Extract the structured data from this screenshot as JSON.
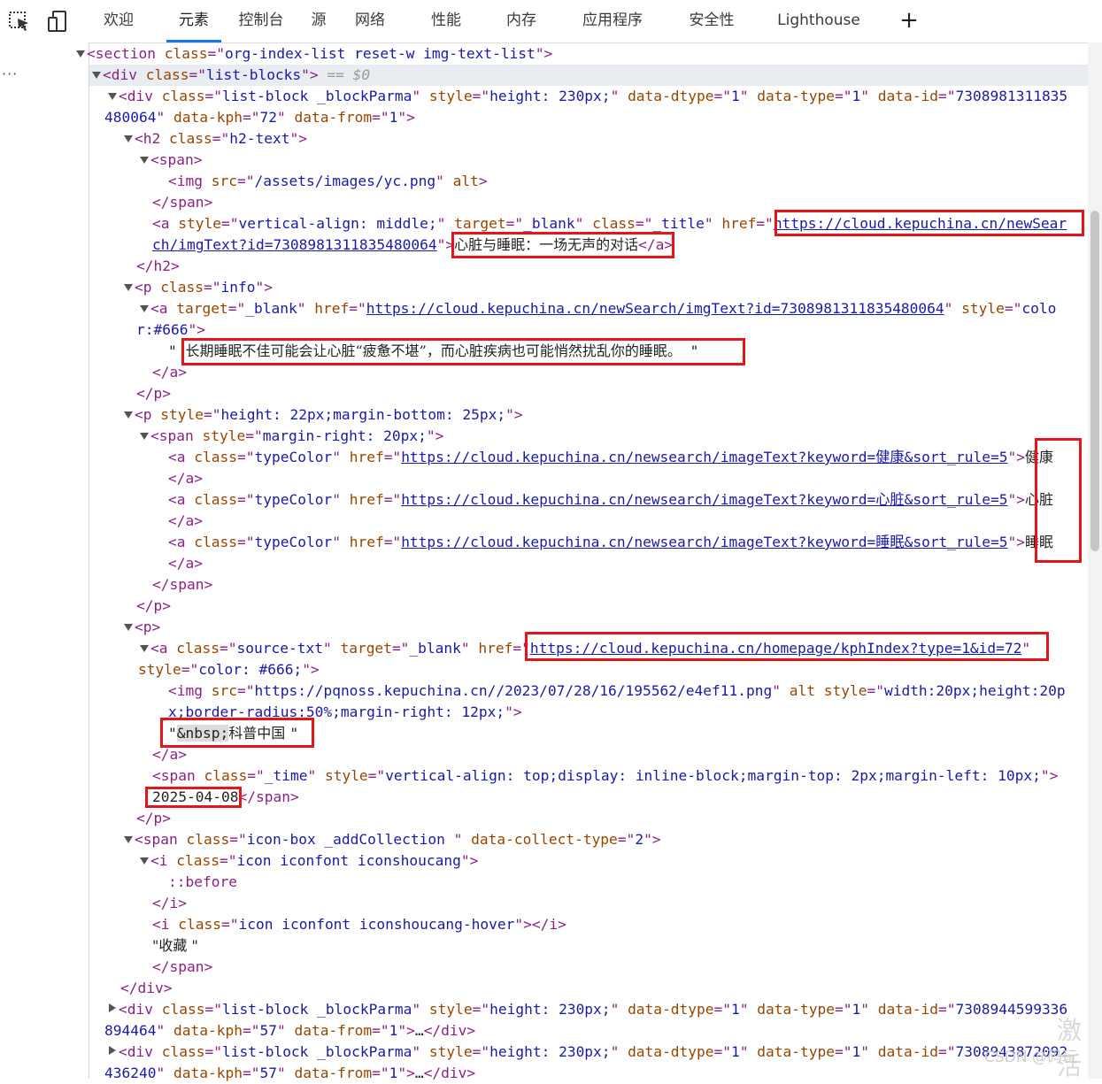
{
  "toolbar": {
    "tabs": [
      "欢迎",
      "元素",
      "控制台",
      "源",
      "网络",
      "性能",
      "内存",
      "应用程序",
      "安全性",
      "Lighthouse"
    ],
    "active_tab": "元素",
    "add_tab_label": "+"
  },
  "gutter": {
    "ellipsis": "···"
  },
  "dom": {
    "l01": [
      "<section ",
      "class",
      "=\"",
      "org-index-list reset-w img-text-list",
      "\">"
    ],
    "l02": [
      "<div ",
      "class",
      "=\"",
      "list-blocks",
      "\">",
      " == $0"
    ],
    "l03": [
      "<div ",
      "class",
      "=\"",
      "list-block _blockParma",
      "\" ",
      "style",
      "=\"",
      "height: 230px;",
      "\" ",
      "data-dtype",
      "=\"",
      "1",
      "\" ",
      "data-type",
      "=\"",
      "1",
      "\" ",
      "data-id",
      "=\"",
      "7308981311835"
    ],
    "l04": [
      "480064",
      "\" ",
      "data-kph",
      "=\"",
      "72",
      "\" ",
      "data-from",
      "=\"",
      "1",
      "\">"
    ],
    "l05": [
      "<h2 ",
      "class",
      "=\"",
      "h2-text",
      "\">"
    ],
    "l06": [
      "<span>"
    ],
    "l07": [
      "<img ",
      "src",
      "=\"",
      "/assets/images/yc.png",
      "\" ",
      "alt",
      ">"
    ],
    "l08": [
      "</span>"
    ],
    "l09": [
      "<a ",
      "style",
      "=\"",
      "vertical-align: middle;",
      "\" ",
      "target",
      "=\"",
      "_blank",
      "\" ",
      "class",
      "=\"",
      "_title",
      "\" ",
      "href",
      "=\"",
      "https://cloud.kepuchina.cn/newSear"
    ],
    "l10": [
      "ch/imgText?id=7308981311835480064",
      "\">",
      "心脏与睡眠：一场无声的对话",
      "</a>"
    ],
    "l11": [
      "</h2>"
    ],
    "l12": [
      "<p ",
      "class",
      "=\"",
      "info",
      "\">"
    ],
    "l13": [
      "<a ",
      "target",
      "=\"",
      "_blank",
      "\" ",
      "href",
      "=\"",
      "https://cloud.kepuchina.cn/newSearch/imgText?id=7308981311835480064",
      "\" ",
      "style",
      "=\"",
      "colo"
    ],
    "l14": [
      "r:#666",
      "\">"
    ],
    "l15": [
      "\" ",
      "长期睡眠不佳可能会让心脏“疲惫不堪”，而心脏疾病也可能悄然扰乱你的睡眠。",
      " \""
    ],
    "l16": [
      "</a>"
    ],
    "l17": [
      "</p>"
    ],
    "l18": [
      "<p ",
      "style",
      "=\"",
      "height: 22px;margin-bottom: 25px;",
      "\">"
    ],
    "l19": [
      "<span ",
      "style",
      "=\"",
      "margin-right: 20px;",
      "\">"
    ],
    "l20": [
      "<a ",
      "class",
      "=\"",
      "typeColor",
      "\" ",
      "href",
      "=\"",
      "https://cloud.kepuchina.cn/newsearch/imageText?keyword=健康&sort_rule=5",
      "\">",
      "健康"
    ],
    "l21": [
      "</a>"
    ],
    "l22": [
      "<a ",
      "class",
      "=\"",
      "typeColor",
      "\" ",
      "href",
      "=\"",
      "https://cloud.kepuchina.cn/newsearch/imageText?keyword=心脏&sort_rule=5",
      "\">",
      "心脏"
    ],
    "l23": [
      "</a>"
    ],
    "l24": [
      "<a ",
      "class",
      "=\"",
      "typeColor",
      "\" ",
      "href",
      "=\"",
      "https://cloud.kepuchina.cn/newsearch/imageText?keyword=睡眠&sort_rule=5",
      "\">",
      "睡眠"
    ],
    "l25": [
      "</a>"
    ],
    "l26": [
      "</span>"
    ],
    "l27": [
      "</p>"
    ],
    "l28": [
      "<p>"
    ],
    "l29": [
      "<a ",
      "class",
      "=\"",
      "source-txt",
      "\" ",
      "target",
      "=\"",
      "_blank",
      "\" ",
      "href",
      "=\"",
      "https://cloud.kepuchina.cn/homepage/kphIndex?type=1&id=72",
      "\""
    ],
    "l30": [
      "style",
      "=\"",
      "color: #666;",
      "\">"
    ],
    "l31": [
      "<img ",
      "src",
      "=\"",
      "https://pqnoss.kepuchina.cn//2023/07/28/16/195562/e4ef11.png",
      "\" ",
      "alt ",
      "style",
      "=\"",
      "width:20px;height:20p"
    ],
    "l32": [
      "x;border-radius:50%;margin-right: 12px;",
      "\">"
    ],
    "l33": [
      "\"",
      "&nbsp;",
      "科普中国 ",
      "\""
    ],
    "l34": [
      "</a>"
    ],
    "l35": [
      "<span ",
      "class",
      "=\"",
      "_time",
      "\" ",
      "style",
      "=\"",
      "vertical-align: top;display: inline-block;margin-top: 2px;margin-left: 10px;",
      "\">"
    ],
    "l36": [
      "2025-04-08",
      "</span>"
    ],
    "l37": [
      "</p>"
    ],
    "l38": [
      "<span ",
      "class",
      "=\"",
      "icon-box _addCollection ",
      "\" ",
      "data-collect-type",
      "=\"",
      "2",
      "\">"
    ],
    "l39": [
      "<i ",
      "class",
      "=\"",
      "icon iconfont iconshoucang",
      "\">"
    ],
    "l40": [
      "::before"
    ],
    "l41": [
      "</i>"
    ],
    "l42": [
      "<i ",
      "class",
      "=\"",
      "icon iconfont iconshoucang-hover",
      "\">",
      "</i>"
    ],
    "l43": [
      "\"收藏 \""
    ],
    "l44": [
      "</span>"
    ],
    "l45": [
      "</div>"
    ],
    "l46": [
      "<div ",
      "class",
      "=\"",
      "list-block _blockParma",
      "\" ",
      "style",
      "=\"",
      "height: 230px;",
      "\" ",
      "data-dtype",
      "=\"",
      "1",
      "\" ",
      "data-type",
      "=\"",
      "1",
      "\" ",
      "data-id",
      "=\"",
      "7308944599336"
    ],
    "l47": [
      "894464",
      "\" ",
      "data-kph",
      "=\"",
      "57",
      "\" ",
      "data-from",
      "=\"",
      "1",
      "\">",
      "…",
      "</div>"
    ],
    "l48": [
      "<div ",
      "class",
      "=\"",
      "list-block _blockParma",
      "\" ",
      "style",
      "=\"",
      "height: 230px;",
      "\" ",
      "data-dtype",
      "=\"",
      "1",
      "\" ",
      "data-type",
      "=\"",
      "1",
      "\" ",
      "data-id",
      "=\"",
      "7308943872092"
    ],
    "l49": [
      "436240",
      "\" ",
      "data-kph",
      "=\"",
      "57",
      "\" ",
      "data-from",
      "=\"",
      "1",
      "\">",
      "…",
      "</div>"
    ]
  },
  "watermark": {
    "text": "CSDN @码玩",
    "corner": "激活"
  },
  "colors": {
    "tag": "#8a2283",
    "attr_name": "#994500",
    "attr_value": "#1a1aa6",
    "highlight": "#e5151c",
    "active_tab": "#1a73e8"
  }
}
